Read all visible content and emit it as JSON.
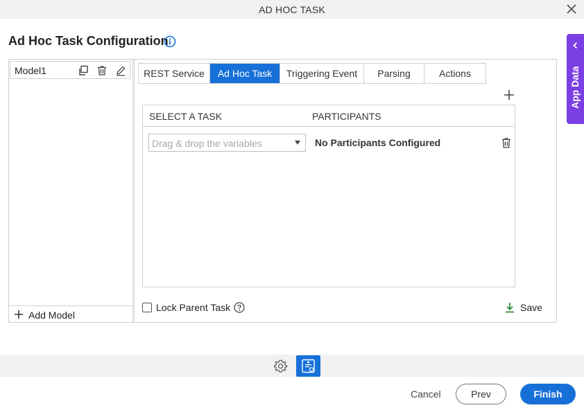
{
  "dialog": {
    "title": "AD HOC TASK",
    "close_icon": "close-icon"
  },
  "page": {
    "heading": "Ad Hoc Task Configuration",
    "info_icon": "info-icon"
  },
  "app_data_panel": {
    "label": "App Data",
    "color": "#7b3fe4",
    "icon": "chevron-left-icon"
  },
  "models": {
    "items": [
      {
        "name": "Model1",
        "icons": [
          "copy-icon",
          "trash-icon",
          "edit-icon"
        ]
      }
    ],
    "add_label": "Add Model"
  },
  "tabs": [
    {
      "label": "REST Service",
      "active": false
    },
    {
      "label": "Ad Hoc Task",
      "active": true
    },
    {
      "label": "Triggering Event",
      "active": false
    },
    {
      "label": "Parsing",
      "active": false
    },
    {
      "label": "Actions",
      "active": false
    }
  ],
  "grid": {
    "columns": [
      "SELECT A TASK",
      "PARTICIPANTS"
    ],
    "rows": [
      {
        "task_placeholder": "Drag & drop the variables",
        "participants": "No Participants Configured"
      }
    ]
  },
  "footer_panel": {
    "lock_label": "Lock Parent Task",
    "lock_checked": false,
    "save_label": "Save",
    "save_icon_color": "#2e8b3e"
  },
  "bottom_toolbar": {
    "icons": [
      "gear-icon",
      "form-icon"
    ]
  },
  "actions": {
    "cancel": "Cancel",
    "prev": "Prev",
    "finish": "Finish"
  },
  "colors": {
    "accent": "#1670d8",
    "purple": "#7b3fe4"
  }
}
